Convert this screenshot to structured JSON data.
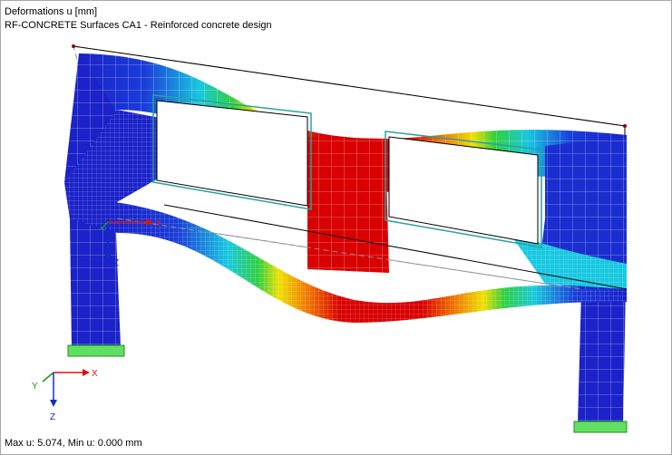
{
  "viewport": {
    "title_line1": "Deformations u [mm]",
    "title_line2": "RF-CONCRETE Surfaces CA1 - Reinforced concrete design",
    "status": "Max u: 5.074, Min u: 0.000 mm"
  },
  "local_axes": {
    "x": "X",
    "z": "Z"
  },
  "global_axes": {
    "x": "X",
    "y": "Y",
    "z": "Z"
  },
  "colors": {
    "deform_low": "#1a22c8",
    "deform_mid": "#18c8e0",
    "deform_green": "#30d040",
    "deform_yellow": "#f0e000",
    "deform_high": "#d80000",
    "support": "#60e060",
    "opening_outline": "#2aa0a0",
    "axis_x": "#e01010",
    "axis_y": "#10a010",
    "axis_z": "#1030c0"
  }
}
